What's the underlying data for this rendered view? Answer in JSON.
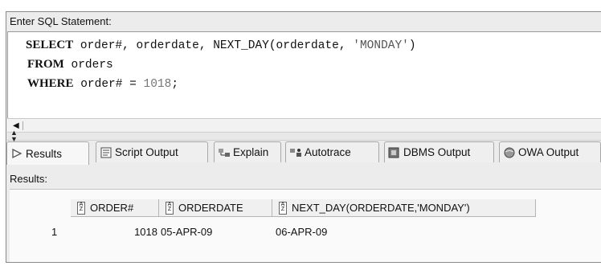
{
  "editor": {
    "label": "Enter SQL Statement:",
    "line1": {
      "kw": "SELECT",
      "pre": " order#, orderdate, NEXT_DAY(orderdate, ",
      "str": "'MONDAY'",
      "post": ")"
    },
    "line2": {
      "kw": "FROM",
      "rest": " orders"
    },
    "line3": {
      "kw": "WHERE",
      "pre": " order# = ",
      "num": "1018",
      "post": ";"
    }
  },
  "tabs": [
    {
      "label": "Results",
      "icon": "play-arrow-icon"
    },
    {
      "label": "Script Output",
      "icon": "script-icon"
    },
    {
      "label": "Explain",
      "icon": "explain-plan-icon"
    },
    {
      "label": "Autotrace",
      "icon": "autotrace-icon"
    },
    {
      "label": "DBMS Output",
      "icon": "dbms-output-icon"
    },
    {
      "label": "OWA Output",
      "icon": "owa-globe-icon"
    }
  ],
  "results": {
    "label": "Results:",
    "columns": [
      "ORDER#",
      "ORDERDATE",
      "NEXT_DAY(ORDERDATE,'MONDAY')"
    ],
    "rows": [
      {
        "row_num": "1",
        "order": "1018",
        "orderdate": "05-APR-09",
        "next_day": "06-APR-09"
      }
    ]
  }
}
